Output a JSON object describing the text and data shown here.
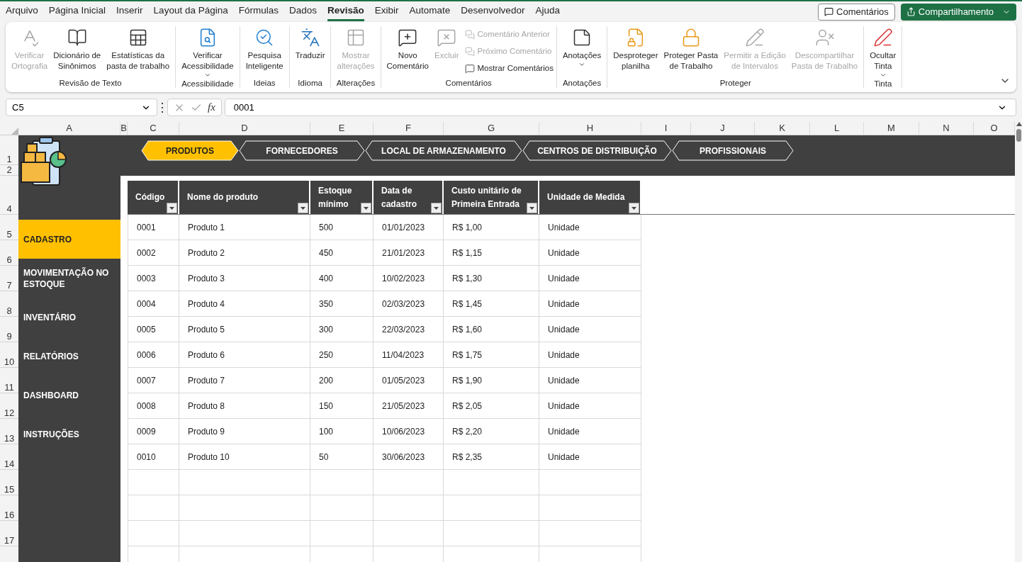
{
  "menu": {
    "tabs": [
      {
        "label": "Arquivo",
        "selected": false
      },
      {
        "label": "Página Inicial",
        "selected": false
      },
      {
        "label": "Inserir",
        "selected": false
      },
      {
        "label": "Layout da Página",
        "selected": false
      },
      {
        "label": "Fórmulas",
        "selected": false
      },
      {
        "label": "Dados",
        "selected": false
      },
      {
        "label": "Revisão",
        "selected": true
      },
      {
        "label": "Exibir",
        "selected": false
      },
      {
        "label": "Automate",
        "selected": false
      },
      {
        "label": "Desenvolvedor",
        "selected": false
      },
      {
        "label": "Ajuda",
        "selected": false
      }
    ],
    "comments_button": "Comentários",
    "share_button": "Compartilhamento"
  },
  "ribbon": {
    "groups": [
      {
        "label": "Revisão de Texto",
        "buttons": [
          {
            "kind": "large",
            "label": "Verificar\nOrtografia",
            "disabled": true,
            "dropdown": false
          },
          {
            "kind": "large",
            "label": "Dicionário de\nSinônimos",
            "disabled": false,
            "dropdown": false
          },
          {
            "kind": "large",
            "label": "Estatísticas da\npasta de trabalho",
            "disabled": false,
            "dropdown": false
          }
        ]
      },
      {
        "label": "Acessibilidade",
        "buttons": [
          {
            "kind": "large",
            "label": "Verificar\nAcessibilidade",
            "disabled": false,
            "dropdown": true
          }
        ]
      },
      {
        "label": "Ideias",
        "buttons": [
          {
            "kind": "large",
            "label": "Pesquisa\nInteligente",
            "disabled": false,
            "dropdown": false
          }
        ]
      },
      {
        "label": "Idioma",
        "buttons": [
          {
            "kind": "large",
            "label": "Traduzir",
            "disabled": false,
            "dropdown": false
          }
        ]
      },
      {
        "label": "Alterações",
        "buttons": [
          {
            "kind": "large",
            "label": "Mostrar\nalterações",
            "disabled": true,
            "dropdown": false
          }
        ]
      },
      {
        "label": "Comentários",
        "buttons": [
          {
            "kind": "large",
            "label": "Novo\nComentário",
            "disabled": false,
            "dropdown": false
          },
          {
            "kind": "large",
            "label": "Excluir",
            "disabled": true,
            "dropdown": false
          },
          {
            "kind": "small",
            "label": "Comentário Anterior",
            "disabled": true
          },
          {
            "kind": "small",
            "label": "Próximo Comentário",
            "disabled": true
          },
          {
            "kind": "small",
            "label": "Mostrar Comentários",
            "disabled": false
          }
        ]
      },
      {
        "label": "Anotações",
        "buttons": [
          {
            "kind": "large",
            "label": "Anotações",
            "disabled": false,
            "dropdown": true
          }
        ]
      },
      {
        "label": "Proteger",
        "buttons": [
          {
            "kind": "large",
            "label": "Desproteger\nplanilha",
            "disabled": false,
            "dropdown": false
          },
          {
            "kind": "large",
            "label": "Proteger Pasta\nde Trabalho",
            "disabled": false,
            "dropdown": false
          },
          {
            "kind": "large",
            "label": "Permitir a Edição\nde Intervalos",
            "disabled": true,
            "dropdown": false
          },
          {
            "kind": "large",
            "label": "Descompartilhar\nPasta de Trabalho",
            "disabled": true,
            "dropdown": false
          }
        ]
      },
      {
        "label": "Tinta",
        "buttons": [
          {
            "kind": "large",
            "label": "Ocultar\nTinta",
            "disabled": false,
            "dropdown": true
          }
        ]
      }
    ]
  },
  "formula_bar": {
    "name_box": "C5",
    "function_label": "fx",
    "formula": "0001"
  },
  "column_headers": [
    "A",
    "B",
    "C",
    "D",
    "E",
    "F",
    "G",
    "H",
    "I",
    "J",
    "K",
    "L",
    "M",
    "N",
    "O"
  ],
  "row_headers": [
    "1",
    "2",
    "4",
    "5",
    "6",
    "7",
    "8",
    "9",
    "10",
    "11",
    "12",
    "13",
    "14",
    "15",
    "16",
    "17"
  ],
  "sheet": {
    "tabs": [
      {
        "label": "PRODUTOS",
        "selected": true
      },
      {
        "label": "FORNECEDORES",
        "selected": false
      },
      {
        "label": "LOCAL DE ARMAZENAMENTO",
        "selected": false
      },
      {
        "label": "CENTROS DE DISTRIBUIÇÃO",
        "selected": false
      },
      {
        "label": "PROFISSIONAIS",
        "selected": false
      }
    ],
    "nav": [
      {
        "label": "CADASTRO",
        "selected": true
      },
      {
        "label": "MOVIMENTAÇÃO NO ESTOQUE",
        "selected": false
      },
      {
        "label": "INVENTÁRIO",
        "selected": false
      },
      {
        "label": "RELATÓRIOS",
        "selected": false
      },
      {
        "label": "DASHBOARD",
        "selected": false
      },
      {
        "label": "INSTRUÇÕES",
        "selected": false
      }
    ],
    "table": {
      "columns": [
        "Código",
        "Nome do produto",
        "Estoque mínimo",
        "Data de cadastro",
        "Custo unitário de Primeira Entrada",
        "Unidade de Medida"
      ],
      "rows": [
        [
          "0001",
          "Produto 1",
          "500",
          "01/01/2023",
          "R$ 1,00",
          "Unidade"
        ],
        [
          "0002",
          "Produto 2",
          "450",
          "21/01/2023",
          "R$ 1,15",
          "Unidade"
        ],
        [
          "0003",
          "Produto 3",
          "400",
          "10/02/2023",
          "R$ 1,30",
          "Unidade"
        ],
        [
          "0004",
          "Produto 4",
          "350",
          "02/03/2023",
          "R$ 1,45",
          "Unidade"
        ],
        [
          "0005",
          "Produto 5",
          "300",
          "22/03/2023",
          "R$ 1,60",
          "Unidade"
        ],
        [
          "0006",
          "Produto 6",
          "250",
          "11/04/2023",
          "R$ 1,75",
          "Unidade"
        ],
        [
          "0007",
          "Produto 7",
          "200",
          "01/05/2023",
          "R$ 1,90",
          "Unidade"
        ],
        [
          "0008",
          "Produto 8",
          "150",
          "21/05/2023",
          "R$ 2,05",
          "Unidade"
        ],
        [
          "0009",
          "Produto 9",
          "100",
          "10/06/2023",
          "R$ 2,20",
          "Unidade"
        ],
        [
          "0010",
          "Produto 10",
          "50",
          "30/06/2023",
          "R$ 2,35",
          "Unidade"
        ]
      ]
    }
  }
}
